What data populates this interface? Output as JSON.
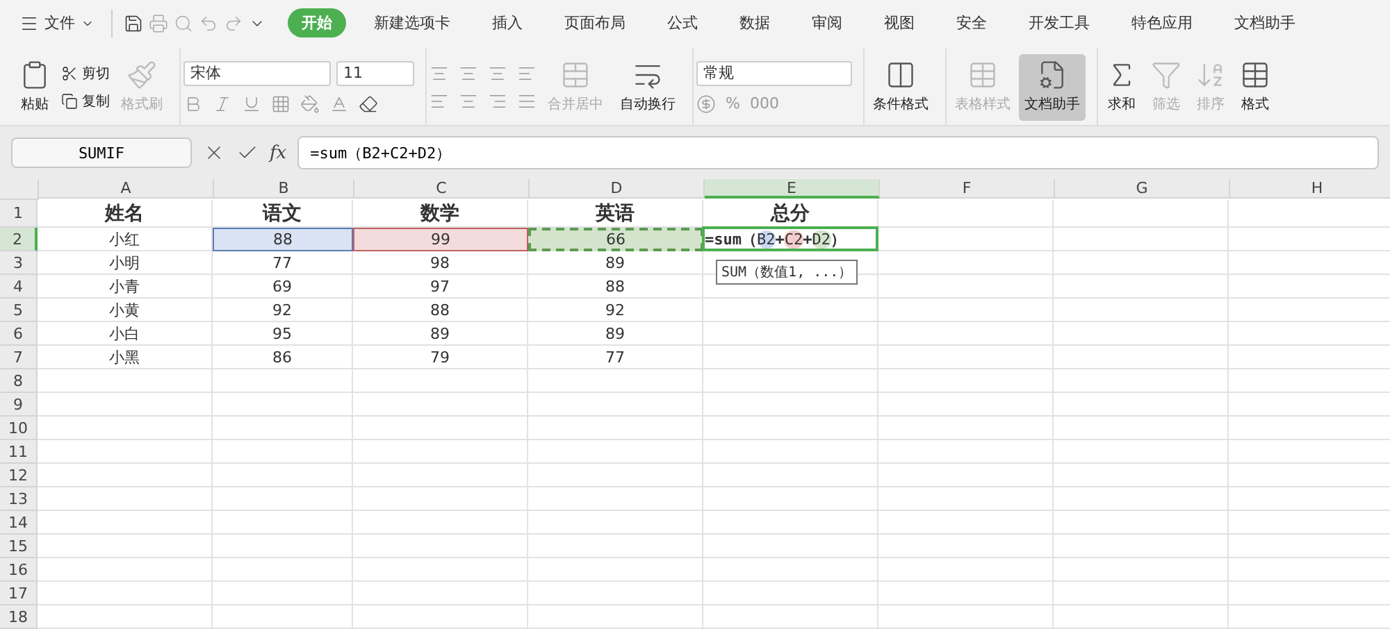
{
  "menu": {
    "label": "文件"
  },
  "tabs": [
    {
      "label": "开始",
      "selected": true
    },
    {
      "label": "新建选项卡",
      "selected": false
    },
    {
      "label": "插入",
      "selected": false
    },
    {
      "label": "页面布局",
      "selected": false
    },
    {
      "label": "公式",
      "selected": false
    },
    {
      "label": "数据",
      "selected": false
    },
    {
      "label": "审阅",
      "selected": false
    },
    {
      "label": "视图",
      "selected": false
    },
    {
      "label": "安全",
      "selected": false
    },
    {
      "label": "开发工具",
      "selected": false
    },
    {
      "label": "特色应用",
      "selected": false
    },
    {
      "label": "文档助手",
      "selected": false
    }
  ],
  "ribbon": {
    "paste": {
      "label": "粘贴",
      "disabled": false
    },
    "cut": {
      "label": "剪切",
      "disabled": false
    },
    "copy": {
      "label": "复制",
      "disabled": false
    },
    "format_painter": {
      "label": "格式刷",
      "disabled": true
    },
    "font_name": "宋体",
    "font_size": "11",
    "merge": {
      "label": "合并居中",
      "disabled": true
    },
    "wrap": {
      "label": "自动换行",
      "disabled": false
    },
    "number_format": "常规",
    "number_row": [
      {
        "label": "%"
      },
      {
        "label": "000"
      }
    ],
    "buttons": [
      {
        "label": "条件格式",
        "disabled": false,
        "selected": false
      },
      {
        "label": "表格样式",
        "disabled": true,
        "selected": false
      },
      {
        "label": "文档助手",
        "disabled": false,
        "selected": true
      },
      {
        "label": "求和",
        "disabled": false,
        "selected": false
      },
      {
        "label": "筛选",
        "disabled": true,
        "selected": false
      },
      {
        "label": "排序",
        "disabled": true,
        "selected": false
      },
      {
        "label": "格式",
        "disabled": false,
        "selected": false
      }
    ]
  },
  "name_box": "SUMIF",
  "fx": "fx",
  "formula": "=sum（B2+C2+D2）",
  "columns": [
    {
      "label": "A",
      "selected": false
    },
    {
      "label": "B",
      "selected": false
    },
    {
      "label": "C",
      "selected": false
    },
    {
      "label": "D",
      "selected": false
    },
    {
      "label": "E",
      "selected": true
    },
    {
      "label": "F",
      "selected": false
    },
    {
      "label": "G",
      "selected": false
    },
    {
      "label": "H",
      "selected": false
    }
  ],
  "rows": [
    {
      "label": "1",
      "selected": false,
      "cells": [
        {
          "text": "姓名",
          "kind": "header"
        },
        {
          "text": "语文",
          "kind": "header"
        },
        {
          "text": "数学",
          "kind": "header"
        },
        {
          "text": "英语",
          "kind": "header"
        },
        {
          "text": "总分",
          "kind": "header"
        }
      ]
    },
    {
      "label": "2",
      "selected": true,
      "cells": [
        {
          "text": "小红",
          "kind": "plain"
        },
        {
          "text": "88",
          "kind": "ref",
          "color": "#dae3f3"
        },
        {
          "text": "99",
          "kind": "ref",
          "color": "#f4dcdc"
        },
        {
          "text": "66",
          "kind": "marquee",
          "color": "#d3e3cc"
        },
        {
          "kind": "formula",
          "parts": [
            {
              "text": "=sum（"
            },
            {
              "text": "B2",
              "color": "#c9d7f0"
            },
            {
              "text": "+"
            },
            {
              "text": "C2",
              "color": "#f3cccc"
            },
            {
              "text": "+"
            },
            {
              "text": "D2",
              "color": "#d3e3cc"
            },
            {
              "text": "）"
            }
          ],
          "tooltip": "SUM（数值1, ...）"
        }
      ]
    },
    {
      "label": "3",
      "selected": false,
      "cells": [
        {
          "text": "小明",
          "kind": "plain"
        },
        {
          "text": "77",
          "kind": "plain"
        },
        {
          "text": "98",
          "kind": "plain"
        },
        {
          "text": "89",
          "kind": "plain"
        }
      ]
    },
    {
      "label": "4",
      "selected": false,
      "cells": [
        {
          "text": "小青",
          "kind": "plain"
        },
        {
          "text": "69",
          "kind": "plain"
        },
        {
          "text": "97",
          "kind": "plain"
        },
        {
          "text": "88",
          "kind": "plain"
        }
      ]
    },
    {
      "label": "5",
      "selected": false,
      "cells": [
        {
          "text": "小黄",
          "kind": "plain"
        },
        {
          "text": "92",
          "kind": "plain"
        },
        {
          "text": "88",
          "kind": "plain"
        },
        {
          "text": "92",
          "kind": "plain"
        }
      ]
    },
    {
      "label": "6",
      "selected": false,
      "cells": [
        {
          "text": "小白",
          "kind": "plain"
        },
        {
          "text": "95",
          "kind": "plain"
        },
        {
          "text": "89",
          "kind": "plain"
        },
        {
          "text": "89",
          "kind": "plain"
        }
      ]
    },
    {
      "label": "7",
      "selected": false,
      "cells": [
        {
          "text": "小黑",
          "kind": "plain"
        },
        {
          "text": "86",
          "kind": "plain"
        },
        {
          "text": "79",
          "kind": "plain"
        },
        {
          "text": "77",
          "kind": "plain"
        }
      ]
    },
    {
      "label": "8",
      "selected": false
    },
    {
      "label": "9",
      "selected": false
    },
    {
      "label": "10",
      "selected": false
    },
    {
      "label": "11",
      "selected": false
    },
    {
      "label": "12",
      "selected": false
    },
    {
      "label": "13",
      "selected": false
    },
    {
      "label": "14",
      "selected": false
    },
    {
      "label": "15",
      "selected": false
    },
    {
      "label": "16",
      "selected": false
    },
    {
      "label": "17",
      "selected": false
    },
    {
      "label": "18",
      "selected": false
    }
  ]
}
